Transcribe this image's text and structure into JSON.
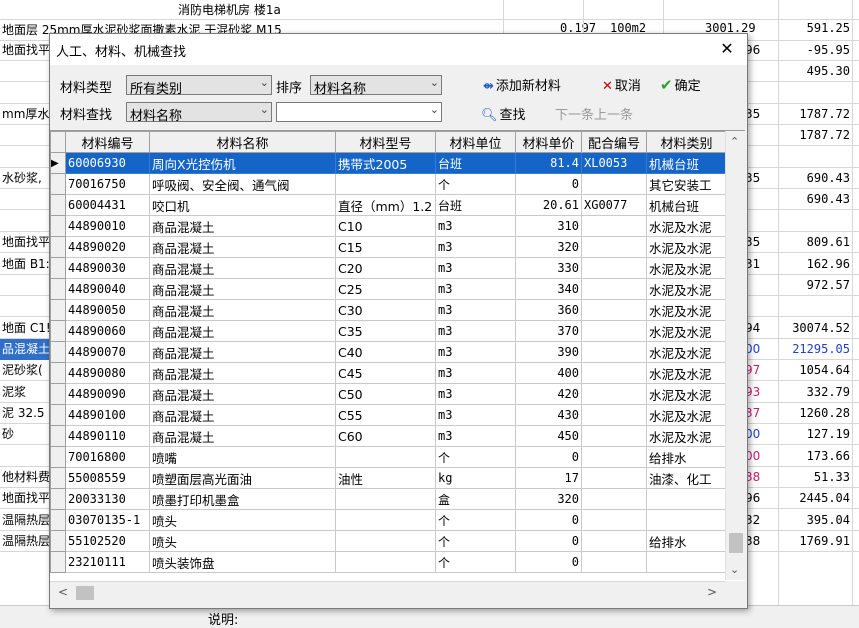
{
  "background": {
    "top_label": "消防电梯机房 楼1a",
    "row2_text": "地面层 25mm厚水泥砂浆面撒素水泥 干混砂浆 M15",
    "row2_values": [
      "0.197",
      "100m2",
      "3001.29",
      "591.25"
    ],
    "rows": [
      {
        "c1": "地面找平",
        "c2": "96",
        "c3": "-95.95"
      },
      {
        "c1": "",
        "c2": "",
        "c3": "495.30"
      },
      {
        "c1": "",
        "c2": "",
        "c3": ""
      },
      {
        "c1": "mm厚水泥",
        "c2": "35",
        "c3": "1787.72"
      },
      {
        "c1": "",
        "c2": "",
        "c3": "1787.72"
      },
      {
        "c1": "",
        "c2": "",
        "c3": ""
      },
      {
        "c1": "水砂浆,",
        "c2": "35",
        "c3": "690.43"
      },
      {
        "c1": "",
        "c2": "",
        "c3": "690.43"
      },
      {
        "c1": "",
        "c2": "",
        "c3": ""
      },
      {
        "c1": "地面找平",
        "c2": "35",
        "c3": "809.61"
      },
      {
        "c1": "地面 B1:",
        "c2": "31",
        "c3": "162.96"
      },
      {
        "c1": "",
        "c2": "",
        "c3": "972.57"
      },
      {
        "c1": "",
        "c2": "",
        "c3": ""
      },
      {
        "c1": "地面 C1!",
        "c2": "94",
        "c3": "30074.52"
      },
      {
        "c1": "品混凝土",
        "c2": "00",
        "c3": "21295.05",
        "sel": true
      },
      {
        "c1": "泥砂浆(",
        "c2": "97",
        "c3": "1054.64"
      },
      {
        "c1": "泥浆",
        "c2": "93",
        "c3": "332.79"
      },
      {
        "c1": "泥 32.5",
        "c2": "37",
        "c3": "1260.28"
      },
      {
        "c1": "砂",
        "c2": "00",
        "c3": "127.19"
      },
      {
        "c1": "",
        "c2": "00",
        "c3": "173.66"
      },
      {
        "c1": "他材料费",
        "c2": "38",
        "c3": "51.33"
      },
      {
        "c1": "地面找平",
        "c2": "96",
        "c3": "2445.04"
      },
      {
        "c1": "温隔热层",
        "c2": "32",
        "c3": "395.04"
      },
      {
        "c1": "温隔热层",
        "c2": "38",
        "c3": "1769.91"
      }
    ],
    "bottom_label": "说明:"
  },
  "dialog": {
    "title": "人工、材料、机械查找",
    "close_label": "✕",
    "material_type_label": "材料类型",
    "material_type_value": "所有类别",
    "sort_label": "排序",
    "sort_value": "材料名称",
    "search_label": "材料查找",
    "search_field_value": "材料名称",
    "search_text_value": "",
    "add_label": "添加新材料",
    "cancel_label": "取消",
    "ok_label": "确定",
    "find_label": "查找",
    "next_prev_label": "下一条上一条"
  },
  "table": {
    "columns": [
      "材料编号",
      "材料名称",
      "材料型号",
      "材料单位",
      "材料单价",
      "配合编号",
      "材料类别"
    ],
    "rows": [
      {
        "code": "60006930",
        "name": "周向X光控伤机",
        "model": "携带式2005",
        "unit": "台班",
        "price": "81.4",
        "mix": "XL0053",
        "category": "机械台班",
        "selected": true
      },
      {
        "code": "70016750",
        "name": "呼吸阀、安全阀、通气阀",
        "model": "",
        "unit": "个",
        "price": "0",
        "mix": "",
        "category": "其它安装工"
      },
      {
        "code": "60004431",
        "name": "咬口机",
        "model": "直径（mm）1.2",
        "unit": "台班",
        "price": "20.61",
        "mix": "XG0077",
        "category": "机械台班"
      },
      {
        "code": "44890010",
        "name": "商品混凝土",
        "model": "C10",
        "unit": "m3",
        "price": "310",
        "mix": "",
        "category": "水泥及水泥"
      },
      {
        "code": "44890020",
        "name": "商品混凝土",
        "model": "C15",
        "unit": "m3",
        "price": "320",
        "mix": "",
        "category": "水泥及水泥"
      },
      {
        "code": "44890030",
        "name": "商品混凝土",
        "model": "C20",
        "unit": "m3",
        "price": "330",
        "mix": "",
        "category": "水泥及水泥"
      },
      {
        "code": "44890040",
        "name": "商品混凝土",
        "model": "C25",
        "unit": "m3",
        "price": "340",
        "mix": "",
        "category": "水泥及水泥"
      },
      {
        "code": "44890050",
        "name": "商品混凝土",
        "model": "C30",
        "unit": "m3",
        "price": "360",
        "mix": "",
        "category": "水泥及水泥"
      },
      {
        "code": "44890060",
        "name": "商品混凝土",
        "model": "C35",
        "unit": "m3",
        "price": "370",
        "mix": "",
        "category": "水泥及水泥"
      },
      {
        "code": "44890070",
        "name": "商品混凝土",
        "model": "C40",
        "unit": "m3",
        "price": "390",
        "mix": "",
        "category": "水泥及水泥"
      },
      {
        "code": "44890080",
        "name": "商品混凝土",
        "model": "C45",
        "unit": "m3",
        "price": "400",
        "mix": "",
        "category": "水泥及水泥"
      },
      {
        "code": "44890090",
        "name": "商品混凝土",
        "model": "C50",
        "unit": "m3",
        "price": "420",
        "mix": "",
        "category": "水泥及水泥"
      },
      {
        "code": "44890100",
        "name": "商品混凝土",
        "model": "C55",
        "unit": "m3",
        "price": "430",
        "mix": "",
        "category": "水泥及水泥"
      },
      {
        "code": "44890110",
        "name": "商品混凝土",
        "model": "C60",
        "unit": "m3",
        "price": "450",
        "mix": "",
        "category": "水泥及水泥"
      },
      {
        "code": "70016800",
        "name": "喷嘴",
        "model": "",
        "unit": "个",
        "price": "0",
        "mix": "",
        "category": "给排水"
      },
      {
        "code": "55008559",
        "name": "喷塑面层高光面油",
        "model": "油性",
        "unit": "kg",
        "price": "17",
        "mix": "",
        "category": "油漆、化工"
      },
      {
        "code": "20033130",
        "name": "喷墨打印机墨盒",
        "model": "",
        "unit": "盒",
        "price": "320",
        "mix": "",
        "category": ""
      },
      {
        "code": "03070135-1",
        "name": "喷头",
        "model": "",
        "unit": "个",
        "price": "0",
        "mix": "",
        "category": ""
      },
      {
        "code": "55102520",
        "name": "喷头",
        "model": "",
        "unit": "个",
        "price": "0",
        "mix": "",
        "category": "给排水"
      },
      {
        "code": "23210111",
        "name": "喷头装饰盘",
        "model": "",
        "unit": "个",
        "price": "0",
        "mix": "",
        "category": ""
      }
    ]
  },
  "icons": {
    "add": "add-material-icon",
    "cancel": "cancel-x-icon",
    "ok": "checkmark-icon",
    "find": "search-icon",
    "row_pointer": "row-pointer-icon"
  },
  "colors": {
    "selection": "#1565c8",
    "cancel_icon": "#cc0000",
    "ok_icon": "#2ca02c",
    "add_icon": "#1b5fbf"
  }
}
